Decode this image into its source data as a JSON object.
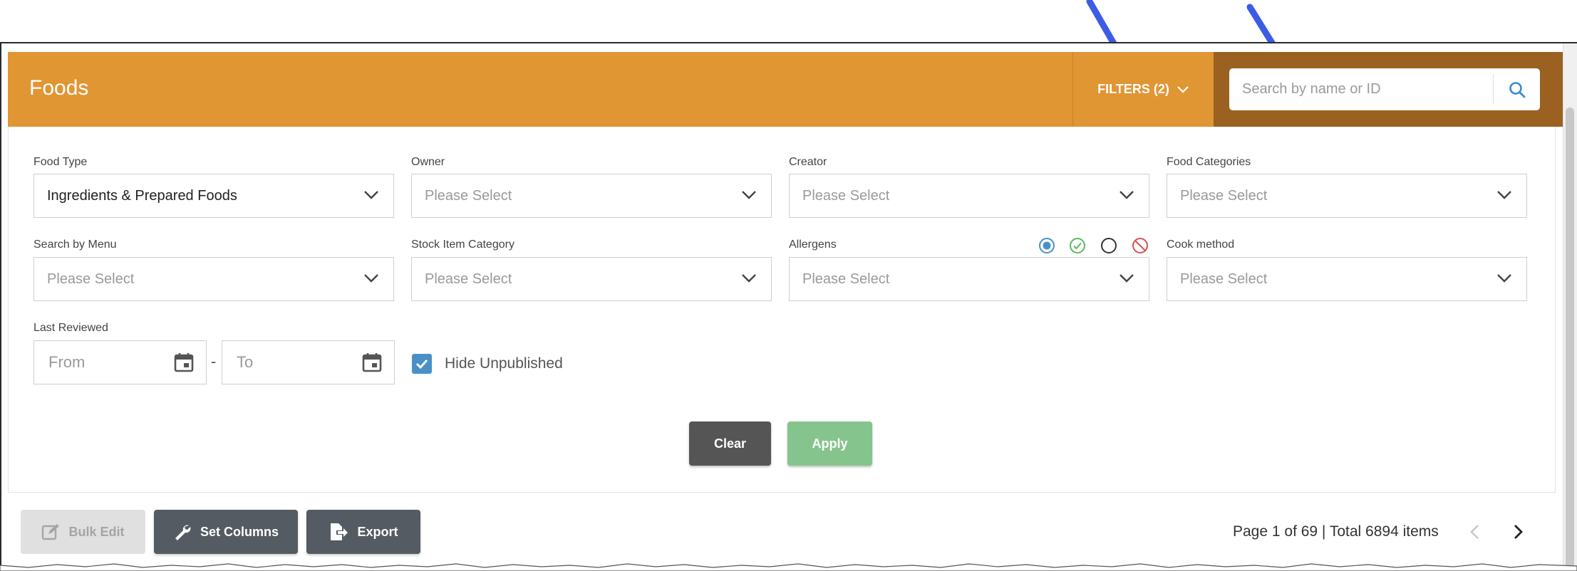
{
  "header": {
    "title": "Foods",
    "filters_label": "FILTERS (2)",
    "search_placeholder": "Search by name or ID"
  },
  "filters": {
    "food_type": {
      "label": "Food Type",
      "value": "Ingredients & Prepared Foods"
    },
    "owner": {
      "label": "Owner",
      "placeholder": "Please Select"
    },
    "creator": {
      "label": "Creator",
      "placeholder": "Please Select"
    },
    "food_categories": {
      "label": "Food Categories",
      "placeholder": "Please Select"
    },
    "search_by_menu": {
      "label": "Search by Menu",
      "placeholder": "Please Select"
    },
    "stock_item_category": {
      "label": "Stock Item Category",
      "placeholder": "Please Select"
    },
    "allergens": {
      "label": "Allergens",
      "placeholder": "Please Select",
      "icons": [
        "radio-selected-icon",
        "check-circle-icon",
        "empty-circle-icon",
        "prohibited-icon"
      ]
    },
    "cook_method": {
      "label": "Cook method",
      "placeholder": "Please Select"
    },
    "last_reviewed": {
      "label": "Last Reviewed",
      "from_placeholder": "From",
      "to_placeholder": "To",
      "separator": "-"
    },
    "hide_unpublished": {
      "label": "Hide Unpublished",
      "checked": true
    }
  },
  "actions": {
    "clear": "Clear",
    "apply": "Apply"
  },
  "toolbar": {
    "bulk_edit": "Bulk Edit",
    "set_columns": "Set Columns",
    "export": "Export"
  },
  "pager": {
    "text": "Page 1 of 69 | Total 6894 items"
  },
  "colors": {
    "header": "#e09633",
    "search_panel": "#9a6120",
    "checkbox": "#4a90c8",
    "apply": "#86c48e",
    "clear": "#555555",
    "annotation_arrow": "#3d5ce6"
  }
}
